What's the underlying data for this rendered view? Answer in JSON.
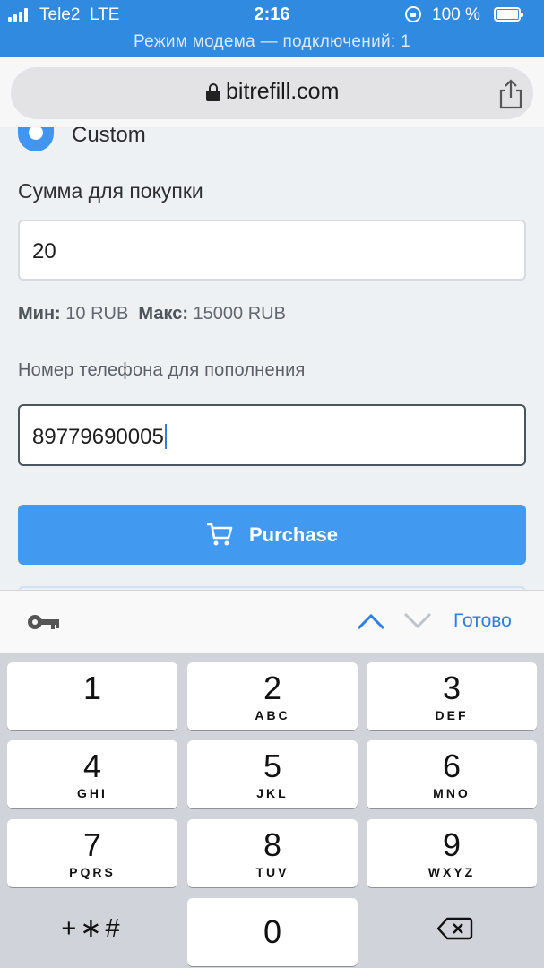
{
  "status_bar": {
    "carrier": "Tele2",
    "network": "LTE",
    "time": "2:16",
    "battery": "100 %",
    "hotspot_text": "Режим модема — подключений: 1"
  },
  "browser": {
    "url": "bitrefill.com"
  },
  "form": {
    "option_label": "Custom",
    "amount_label": "Сумма для покупки",
    "amount_value": "20",
    "min_label": "Мин:",
    "min_value": "10 RUB",
    "max_label": "Макс:",
    "max_value": "15000 RUB",
    "phone_label": "Номер телефона для пополнения",
    "phone_value": "89779690005",
    "purchase_label": "Purchase"
  },
  "accessory": {
    "done_label": "Готово"
  },
  "keypad": {
    "keys": [
      {
        "num": "1",
        "letters": ""
      },
      {
        "num": "2",
        "letters": "ABC"
      },
      {
        "num": "3",
        "letters": "DEF"
      },
      {
        "num": "4",
        "letters": "GHI"
      },
      {
        "num": "5",
        "letters": "JKL"
      },
      {
        "num": "6",
        "letters": "MNO"
      },
      {
        "num": "7",
        "letters": "PQRS"
      },
      {
        "num": "8",
        "letters": "TUV"
      },
      {
        "num": "9",
        "letters": "WXYZ"
      },
      {
        "num": "0",
        "letters": ""
      }
    ],
    "symbols": "+∗#"
  },
  "colors": {
    "status_bar": "#2f8ae0",
    "accent": "#4199f0",
    "done": "#2f7de6"
  }
}
